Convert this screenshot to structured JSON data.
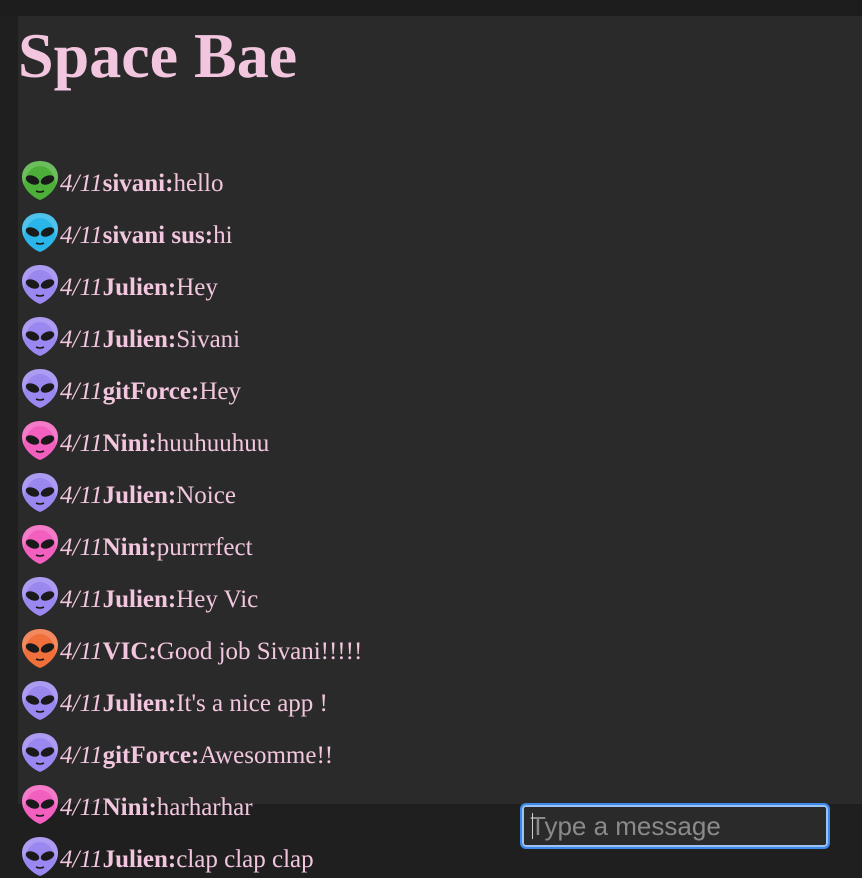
{
  "app": {
    "title": "Space Bae"
  },
  "composer": {
    "placeholder": "Type a message"
  },
  "messages": [
    {
      "avatar_color": "#4caf3a",
      "date": "4/11",
      "user": "sivani:",
      "text": "hello"
    },
    {
      "avatar_color": "#2ab6e8",
      "date": "4/11",
      "user": "sivani sus:",
      "text": "hi"
    },
    {
      "avatar_color": "#9b87f0",
      "date": "4/11",
      "user": "Julien:",
      "text": "Hey"
    },
    {
      "avatar_color": "#9b87f0",
      "date": "4/11",
      "user": "Julien:",
      "text": "Sivani"
    },
    {
      "avatar_color": "#9b87f0",
      "date": "4/11",
      "user": "gitForce:",
      "text": "Hey"
    },
    {
      "avatar_color": "#f25fbf",
      "date": "4/11",
      "user": "Nini:",
      "text": "huuhuuhuu"
    },
    {
      "avatar_color": "#9b87f0",
      "date": "4/11",
      "user": "Julien:",
      "text": "Noice"
    },
    {
      "avatar_color": "#f25fbf",
      "date": "4/11",
      "user": "Nini:",
      "text": "purrrrfect"
    },
    {
      "avatar_color": "#9b87f0",
      "date": "4/11",
      "user": "Julien:",
      "text": "Hey Vic"
    },
    {
      "avatar_color": "#f0703c",
      "date": "4/11",
      "user": "VIC:",
      "text": "Good job Sivani!!!!!"
    },
    {
      "avatar_color": "#9b87f0",
      "date": "4/11",
      "user": "Julien:",
      "text": "It's a nice app !"
    },
    {
      "avatar_color": "#9b87f0",
      "date": "4/11",
      "user": "gitForce:",
      "text": "Awesomme!!"
    },
    {
      "avatar_color": "#f25fbf",
      "date": "4/11",
      "user": "Nini:",
      "text": "harharhar"
    },
    {
      "avatar_color": "#9b87f0",
      "date": "4/11",
      "user": "Julien:",
      "text": "clap clap clap"
    }
  ],
  "colors": {
    "text_pink": "#f2c6de",
    "panel_bg": "#2a2a2a",
    "page_bg": "#1f1f1f",
    "focus_ring": "#3e88ea"
  },
  "icons": {
    "avatar": "alien-icon"
  }
}
